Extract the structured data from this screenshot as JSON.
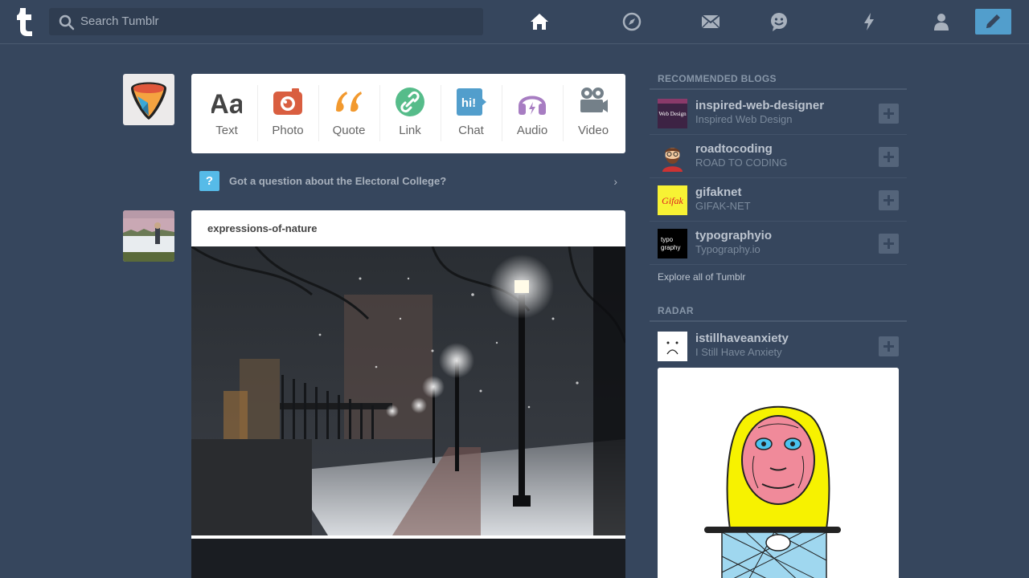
{
  "header": {
    "search_placeholder": "Search Tumblr",
    "nav": [
      "home-icon",
      "explore-icon",
      "inbox-icon",
      "messaging-icon",
      "activity-icon",
      "account-icon",
      "compose-icon"
    ],
    "accent": "#529ecc"
  },
  "post_types": [
    {
      "label": "Text",
      "icon": "text-icon",
      "color": "#444444"
    },
    {
      "label": "Photo",
      "icon": "camera-icon",
      "color": "#d95e40"
    },
    {
      "label": "Quote",
      "icon": "quote-icon",
      "color": "#f2992e"
    },
    {
      "label": "Link",
      "icon": "link-icon",
      "color": "#56bc8a"
    },
    {
      "label": "Chat",
      "icon": "chat-icon",
      "color": "#529ecc"
    },
    {
      "label": "Audio",
      "icon": "headphones-icon",
      "color": "#a77dc2"
    },
    {
      "label": "Video",
      "icon": "video-camera-icon",
      "color": "#748089"
    }
  ],
  "question_banner": {
    "icon_glyph": "?",
    "text": "Got a question about the Electoral College?"
  },
  "post": {
    "blog_name": "expressions-of-nature"
  },
  "sidebar": {
    "recommended_heading": "RECOMMENDED BLOGS",
    "recommended": [
      {
        "name": "inspired-web-designer",
        "title": "Inspired Web Design",
        "avatar_text": "Web Design"
      },
      {
        "name": "roadtocoding",
        "title": "ROAD TO CODING",
        "avatar_text": ""
      },
      {
        "name": "gifaknet",
        "title": "GIFAK-NET",
        "avatar_text": "Gifak"
      },
      {
        "name": "typographyio",
        "title": "Typography.io",
        "avatar_text": "typo graphy"
      }
    ],
    "explore_link": "Explore all of Tumblr",
    "radar_heading": "RADAR",
    "radar": {
      "name": "istillhaveanxiety",
      "title": "I Still Have Anxiety"
    }
  }
}
